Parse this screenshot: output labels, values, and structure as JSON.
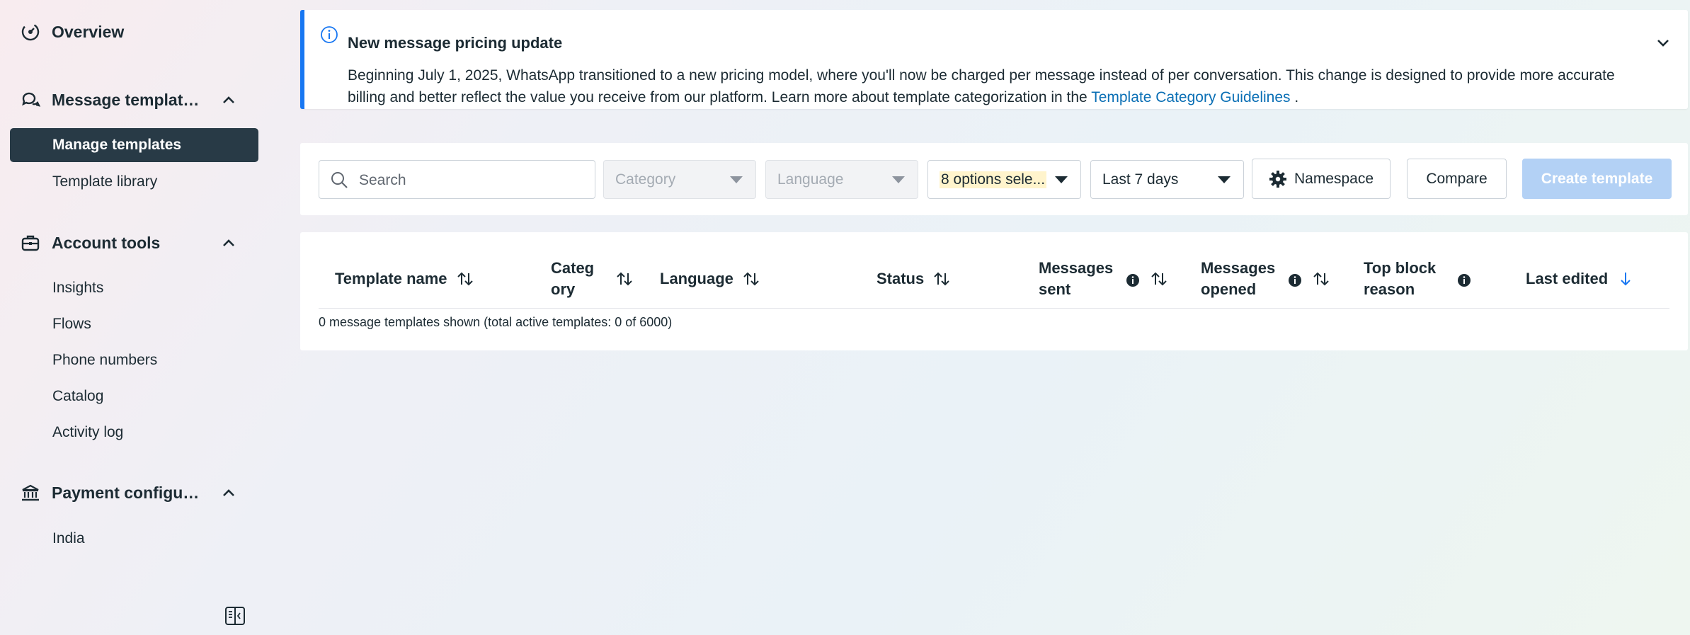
{
  "sidebar": {
    "overview": "Overview",
    "message_templates": {
      "label": "Message templat…",
      "items": [
        {
          "label": "Manage templates",
          "active": true
        },
        {
          "label": "Template library",
          "active": false
        }
      ]
    },
    "account_tools": {
      "label": "Account tools",
      "items": [
        "Insights",
        "Flows",
        "Phone numbers",
        "Catalog",
        "Activity log"
      ]
    },
    "payment_config": {
      "label": "Payment configu…",
      "items": [
        "India"
      ]
    }
  },
  "banner": {
    "title": "New message pricing update",
    "body_text": "Beginning July 1, 2025, WhatsApp transitioned to a new pricing model, where you'll now be charged per message instead of per conversation. This change is designed to provide more accurate billing and better reflect the value you receive from our platform. Learn more about template categorization in the ",
    "link_text": "Template Category Guidelines",
    "body_end": " ."
  },
  "filters": {
    "search_placeholder": "Search",
    "category": "Category",
    "language": "Language",
    "status": "8 options sele...",
    "date_range": "Last 7 days",
    "namespace_button": "Namespace",
    "compare_button": "Compare",
    "create_button": "Create template"
  },
  "table": {
    "columns": {
      "template_name": "Template name",
      "category_1": "Categ",
      "category_2": "ory",
      "language": "Language",
      "status": "Status",
      "messages_sent_1": "Messages",
      "messages_sent_2": "sent",
      "messages_opened_1": "Messages",
      "messages_opened_2": "opened",
      "top_block_1": "Top block",
      "top_block_2": "reason",
      "last_edited": "Last edited"
    },
    "summary": "0 message templates shown (total active templates: 0 of 6000)"
  },
  "colors": {
    "accent": "#1877f2",
    "link": "#0a6fb5",
    "active_nav": "#283a46",
    "create_disabled": "#b3d1f5"
  }
}
